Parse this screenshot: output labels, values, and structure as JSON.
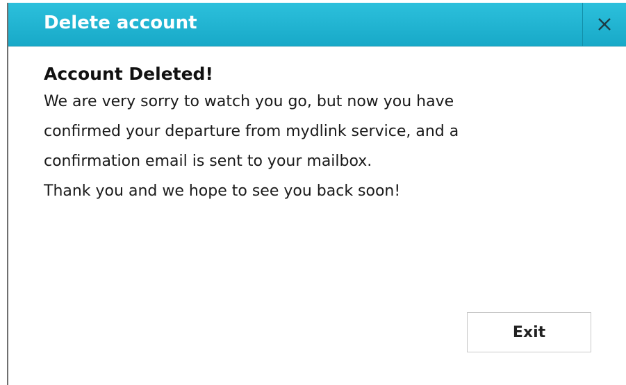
{
  "dialog": {
    "title": "Delete account",
    "close_icon": "close-icon",
    "heading": "Account Deleted!",
    "message_lines": [
      "We are very sorry to watch you go, but now you have",
      "confirmed your departure from mydlink service, and a",
      "confirmation email is sent to your mailbox.",
      "Thank you and we hope to see you back soon!"
    ],
    "exit_label": "Exit"
  },
  "colors": {
    "titlebar": "#1fb4d2",
    "title_text": "#ffffff",
    "body_text": "#1a1a1a"
  }
}
